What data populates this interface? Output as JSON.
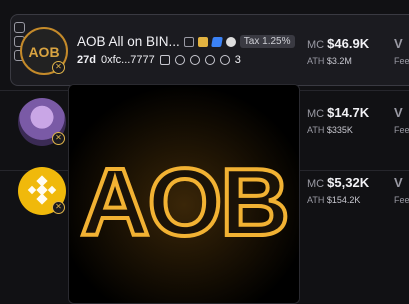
{
  "tokens": [
    {
      "name": "AOB All on BIN...",
      "tax": "Tax 1.25%",
      "age": "27d",
      "address": "0xfc...7777",
      "holders_count": "3",
      "mc_label": "MC",
      "mc_value": "$46.9K",
      "ath_label": "ATH",
      "ath_value": "$3.2M",
      "v_label": "V",
      "f_label": "Fee"
    },
    {
      "mc_label": "MC",
      "mc_value": "$14.7K",
      "ath_label": "ATH",
      "ath_value": "$335K",
      "v_label": "V",
      "f_label": "Fee"
    },
    {
      "mc_label": "MC",
      "mc_value": "$5,32K",
      "ath_label": "ATH",
      "ath_value": "$154.2K",
      "v_label": "V",
      "f_label": "Fee"
    }
  ],
  "popup": {
    "logo_text": "AOB"
  },
  "colors": {
    "accent_gold": "#e0b54a",
    "bnb_yellow": "#f0b90b",
    "background": "#111114",
    "card": "#1b1b20"
  }
}
